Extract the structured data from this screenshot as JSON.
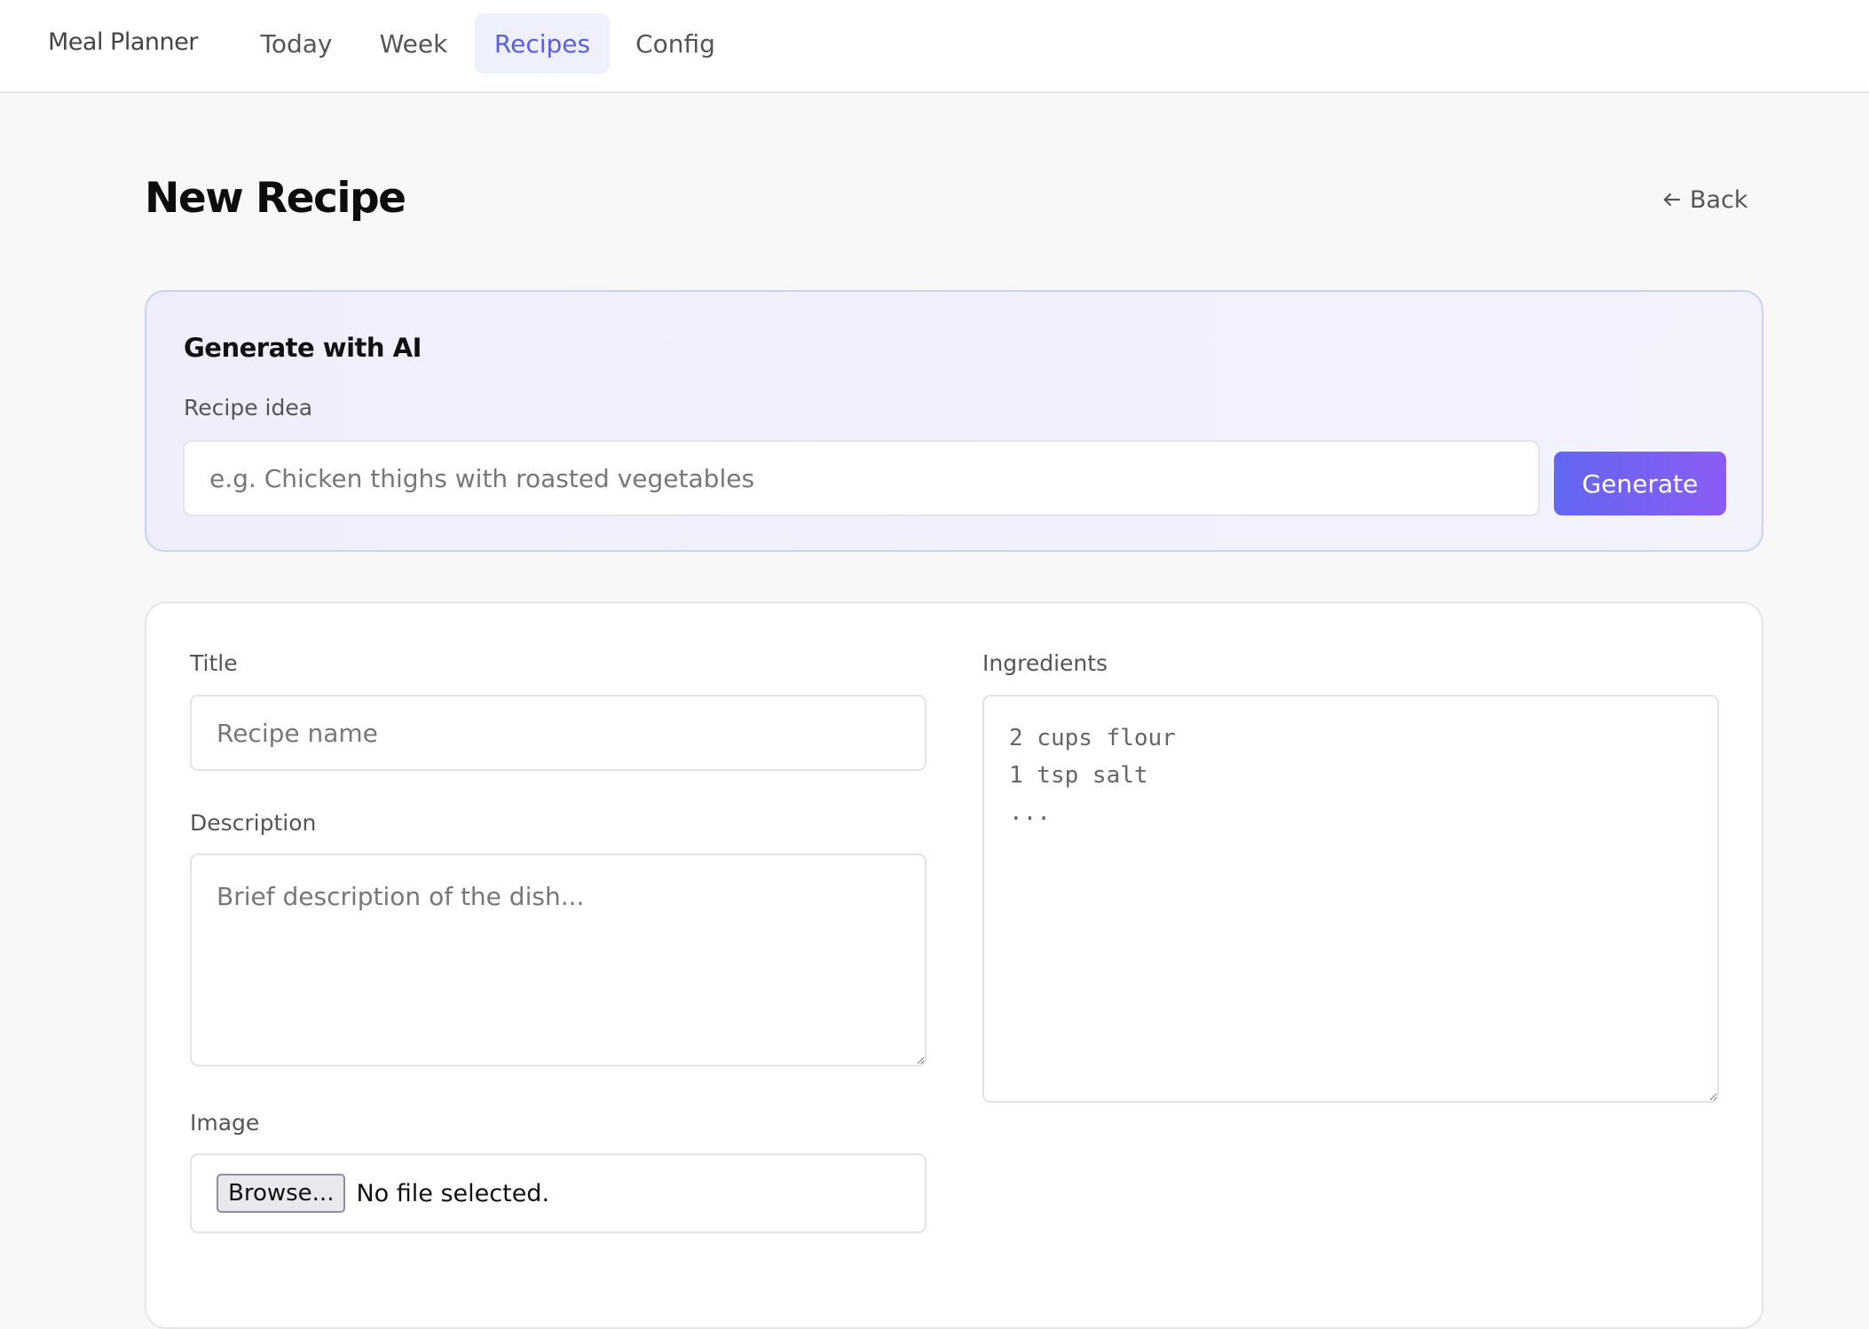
{
  "app": {
    "name": "Meal Planner"
  },
  "nav": {
    "items": [
      {
        "label": "Today"
      },
      {
        "label": "Week"
      },
      {
        "label": "Recipes",
        "active": true
      },
      {
        "label": "Config"
      }
    ]
  },
  "page": {
    "title": "New Recipe",
    "back_label": "Back"
  },
  "ai": {
    "title": "Generate with AI",
    "idea_label": "Recipe idea",
    "idea_placeholder": "e.g. Chicken thighs with roasted vegetables",
    "generate_label": "Generate"
  },
  "form": {
    "title_label": "Title",
    "title_placeholder": "Recipe name",
    "description_label": "Description",
    "description_placeholder": "Brief description of the dish...",
    "image_label": "Image",
    "browse_label": "Browse...",
    "file_status": "No file selected.",
    "ingredients_label": "Ingredients",
    "ingredients_placeholder": "2 cups flour\n1 tsp salt\n..."
  },
  "colors": {
    "accent": "#5a5fe0",
    "active_tab_bg": "#eef0fd",
    "button_gradient_start": "#6366f1",
    "button_gradient_end": "#8b5cf6"
  },
  "icons": {
    "back": "arrow-left-icon"
  }
}
